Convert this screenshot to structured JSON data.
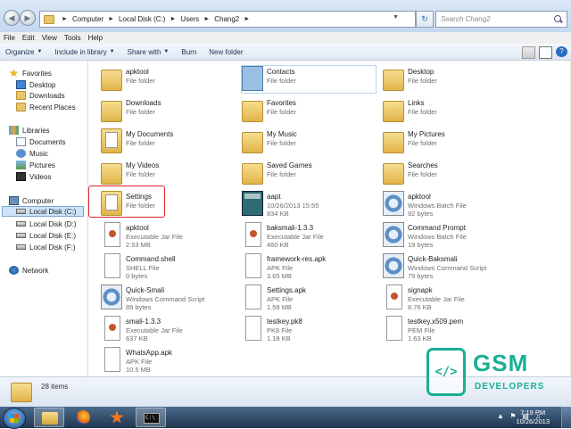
{
  "address": {
    "crumbs": [
      "Computer",
      "Local Disk (C:)",
      "Users",
      "Chang2"
    ],
    "search_placeholder": "Search Chang2"
  },
  "menu": [
    "File",
    "Edit",
    "View",
    "Tools",
    "Help"
  ],
  "toolbar": {
    "organize": "Organize",
    "include": "Include in library",
    "share": "Share with",
    "burn": "Burn",
    "new_folder": "New folder"
  },
  "nav": {
    "favorites": "Favorites",
    "desktop": "Desktop",
    "downloads": "Downloads",
    "recent": "Recent Places",
    "libraries": "Libraries",
    "documents": "Documents",
    "music": "Music",
    "pictures": "Pictures",
    "videos": "Videos",
    "computer": "Computer",
    "disk_c": "Local Disk (C:)",
    "disk_d": "Local Disk (D:)",
    "disk_e": "Local Disk (E:)",
    "disk_f": "Local Disk (F:)",
    "network": "Network"
  },
  "items": [
    {
      "name": "apktool",
      "l2": "File folder",
      "l3": "",
      "icon": "folder"
    },
    {
      "name": "Contacts",
      "l2": "File folder",
      "l3": "",
      "icon": "contacts-folder"
    },
    {
      "name": "Desktop",
      "l2": "File folder",
      "l3": "",
      "icon": "folder"
    },
    {
      "name": "Downloads",
      "l2": "File folder",
      "l3": "",
      "icon": "folder"
    },
    {
      "name": "Favorites",
      "l2": "File folder",
      "l3": "",
      "icon": "folder"
    },
    {
      "name": "Links",
      "l2": "File folder",
      "l3": "",
      "icon": "folder"
    },
    {
      "name": "My Documents",
      "l2": "File folder",
      "l3": "",
      "icon": "doc-folder"
    },
    {
      "name": "My Music",
      "l2": "File folder",
      "l3": "",
      "icon": "folder"
    },
    {
      "name": "My Pictures",
      "l2": "File folder",
      "l3": "",
      "icon": "folder"
    },
    {
      "name": "My Videos",
      "l2": "File folder",
      "l3": "",
      "icon": "folder"
    },
    {
      "name": "Saved Games",
      "l2": "File folder",
      "l3": "",
      "icon": "folder"
    },
    {
      "name": "Searches",
      "l2": "File folder",
      "l3": "",
      "icon": "folder"
    },
    {
      "name": "Settings",
      "l2": "File folder",
      "l3": "",
      "icon": "doc-folder"
    },
    {
      "name": "aapt",
      "l2": "10/26/2013 15:55",
      "l3": "834 KB",
      "icon": "exe"
    },
    {
      "name": "apktool",
      "l2": "Windows Batch File",
      "l3": "92 bytes",
      "icon": "batch"
    },
    {
      "name": "apktool",
      "l2": "Executable Jar File",
      "l3": "2.53 MB",
      "icon": "jar"
    },
    {
      "name": "baksmali-1.3.3",
      "l2": "Executable Jar File",
      "l3": "460 KB",
      "icon": "jar"
    },
    {
      "name": "Command Prompt",
      "l2": "Windows Batch File",
      "l3": "19 bytes",
      "icon": "batch"
    },
    {
      "name": "Command.shell",
      "l2": "SHELL File",
      "l3": "0 bytes",
      "icon": "file"
    },
    {
      "name": "framework-res.apk",
      "l2": "APK File",
      "l3": "3.65 MB",
      "icon": "file"
    },
    {
      "name": "Quick-Baksmali",
      "l2": "Windows Command Script",
      "l3": "79 bytes",
      "icon": "batch"
    },
    {
      "name": "Quick-Smali",
      "l2": "Windows Command Script",
      "l3": "89 bytes",
      "icon": "batch"
    },
    {
      "name": "Settings.apk",
      "l2": "APK File",
      "l3": "1.59 MB",
      "icon": "file"
    },
    {
      "name": "signapk",
      "l2": "Executable Jar File",
      "l3": "8.76 KB",
      "icon": "jar"
    },
    {
      "name": "smali-1.3.3",
      "l2": "Executable Jar File",
      "l3": "637 KB",
      "icon": "jar"
    },
    {
      "name": "testkey.pk8",
      "l2": "PK8 File",
      "l3": "1.18 KB",
      "icon": "file"
    },
    {
      "name": "testkey.x509.pem",
      "l2": "PEM File",
      "l3": "1.63 KB",
      "icon": "file"
    },
    {
      "name": "WhatsApp.apk",
      "l2": "APK File",
      "l3": "10.5 MB",
      "icon": "file"
    }
  ],
  "status": {
    "count": "28 items"
  },
  "watermark": {
    "big": "GSM",
    "small": "DEVELOPERS",
    "glyph": "</>"
  },
  "taskbar": {
    "time": "7:19 PM",
    "date": "10/26/2013",
    "cmd_glyph": "C:\\"
  }
}
